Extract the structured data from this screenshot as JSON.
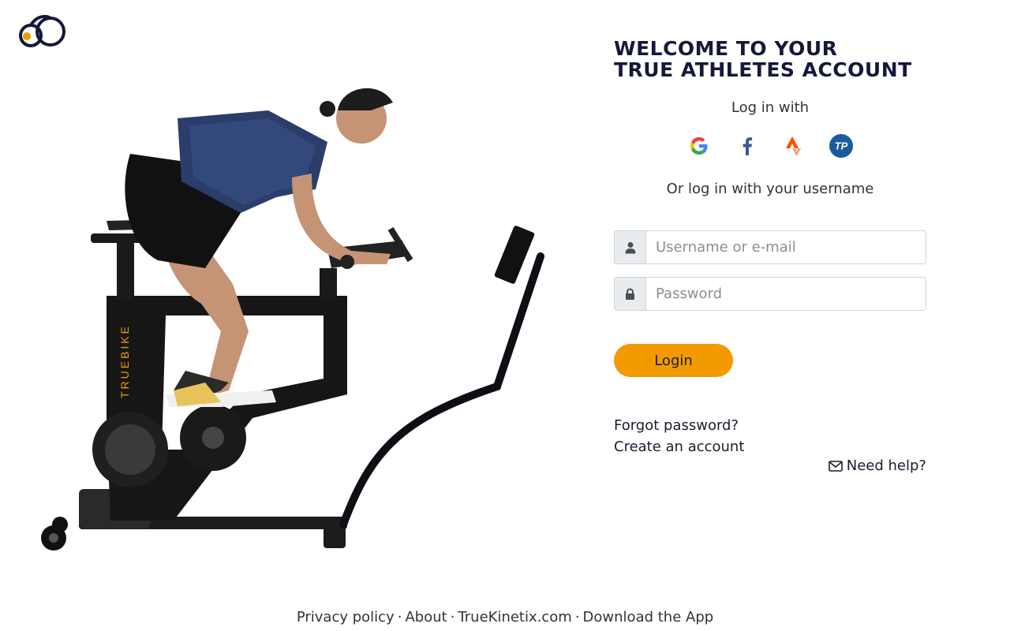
{
  "brand": {
    "logo_icon": "truekinetix-logo-icon",
    "accent_color": "#f29a00",
    "navy_color": "#15183a"
  },
  "hero": {
    "image": "athlete-on-truebike-image",
    "bike_label": "TRUEBIKE"
  },
  "panel": {
    "title_line1": "WELCOME TO YOUR",
    "title_line2": "TRUE ATHLETES ACCOUNT",
    "login_with": "Log in with",
    "social": [
      {
        "name": "google-icon"
      },
      {
        "name": "facebook-icon"
      },
      {
        "name": "strava-icon"
      },
      {
        "name": "trainingpeaks-icon",
        "label": "TP"
      }
    ],
    "or_text": "Or log in with your username",
    "username": {
      "placeholder": "Username or e-mail",
      "value": "",
      "icon": "user-icon"
    },
    "password": {
      "placeholder": "Password",
      "value": "",
      "icon": "lock-icon"
    },
    "login_button": "Login",
    "forgot_password": "Forgot password?",
    "create_account": "Create an account",
    "need_help": "Need help?",
    "help_icon": "envelope-icon"
  },
  "footer": {
    "privacy": "Privacy policy",
    "about": "About",
    "site": "TrueKinetix.com",
    "download": "Download the App",
    "separator": "·"
  }
}
